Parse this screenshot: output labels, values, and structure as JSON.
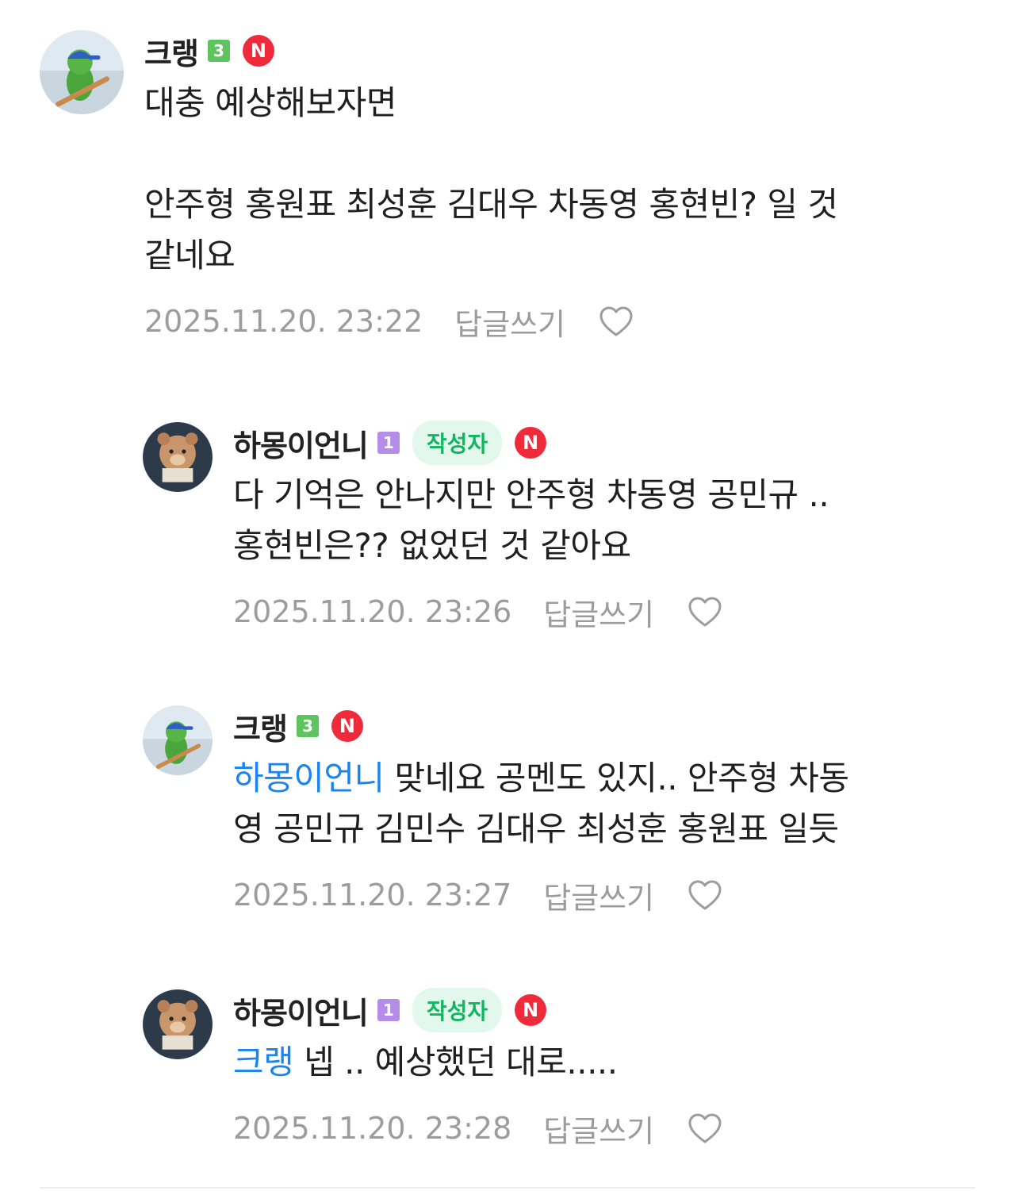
{
  "comments": [
    {
      "nickname": "크랭",
      "level": "3",
      "n_badge": "N",
      "author_tag": "",
      "mention": "",
      "text": "대충 예상해보자면\n\n안주형 홍원표 최성훈 김대우 차동영 홍현빈? 일 것\n같네요",
      "date": "2025.11.20. 23:22",
      "reply_label": "답글쓰기",
      "avatar": "green-frog-baseball-avatar"
    },
    {
      "nickname": "하몽이언니",
      "level": "1",
      "n_badge": "N",
      "author_tag": "작성자",
      "mention": "",
      "text": "다 기억은 안나지만 안주형 차동영 공민규 ..\n홍현빈은?? 없었던 것 같아요",
      "date": "2025.11.20. 23:26",
      "reply_label": "답글쓰기",
      "avatar": "bear-doll-avatar"
    },
    {
      "nickname": "크랭",
      "level": "3",
      "n_badge": "N",
      "author_tag": "",
      "mention": "하몽이언니",
      "text": " 맞네요 공멘도 있지.. 안주형 차동\n영 공민규 김민수 김대우 최성훈 홍원표 일듯",
      "date": "2025.11.20. 23:27",
      "reply_label": "답글쓰기",
      "avatar": "green-frog-baseball-avatar"
    },
    {
      "nickname": "하몽이언니",
      "level": "1",
      "n_badge": "N",
      "author_tag": "작성자",
      "mention": "크랭",
      "text": " 넵 .. 예상했던 대로.....",
      "date": "2025.11.20. 23:28",
      "reply_label": "답글쓰기",
      "avatar": "bear-doll-avatar"
    }
  ],
  "colors": {
    "mention": "#1a84f0",
    "meta": "#9c9c9c",
    "author_tag_bg": "#e3f8ec",
    "author_tag_text": "#12b560",
    "n_badge": "#ef2b3b",
    "level3": "#5dc45f",
    "level1": "#b58ce8"
  }
}
